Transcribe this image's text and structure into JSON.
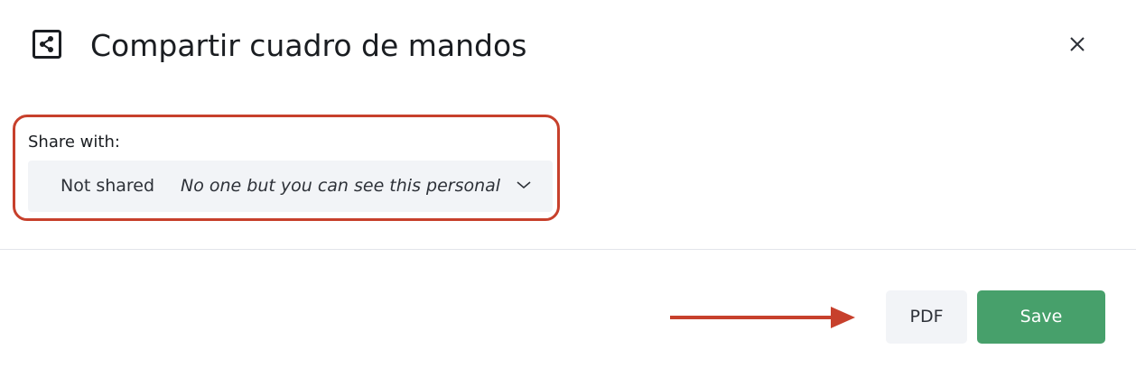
{
  "dialog": {
    "title": "Compartir cuadro de mandos",
    "header_icon": "share-icon",
    "close_icon": "close-icon"
  },
  "share": {
    "label": "Share with:",
    "selected_value": "Not shared",
    "selected_description": "No one but you can see this personal",
    "dropdown_icon": "chevron-down-icon"
  },
  "footer": {
    "pdf_label": "PDF",
    "save_label": "Save"
  },
  "annotations": {
    "highlight_color": "#c7402c",
    "arrow_color": "#c7402c",
    "arrow_icon": "arrow-right-icon"
  },
  "colors": {
    "save_button": "#47a06b",
    "secondary_button": "#f2f4f7"
  }
}
